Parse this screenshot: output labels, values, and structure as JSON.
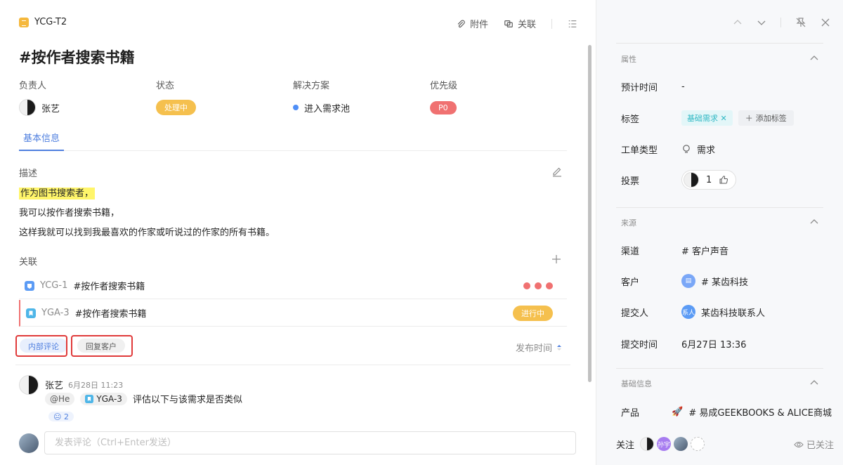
{
  "header": {
    "ticket_id": "YCG-T2",
    "attach_label": "附件",
    "link_label": "关联"
  },
  "title": "#按作者搜索书籍",
  "meta": {
    "assignee_label": "负责人",
    "assignee_name": "张艺",
    "status_label": "状态",
    "status_value": "处理中",
    "solution_label": "解决方案",
    "solution_value": "进入需求池",
    "priority_label": "优先级",
    "priority_value": "P0"
  },
  "tabs": [
    {
      "label": "基本信息",
      "active": true
    }
  ],
  "description": {
    "label": "描述",
    "lines": [
      "作为图书搜索者，",
      "我可以按作者搜索书籍，",
      "这样我就可以找到我最喜欢的作家或听说过的作家的所有书籍。"
    ]
  },
  "relations": {
    "label": "关联",
    "items": [
      {
        "id": "YCG-1",
        "title": "#按作者搜索书籍",
        "icon_color": "#5b9bf5",
        "status": "",
        "dots": 3
      },
      {
        "id": "YGA-3",
        "title": "#按作者搜索书籍",
        "icon_color": "#4fb6e8",
        "status": "进行中",
        "dots": 0
      }
    ]
  },
  "comments": {
    "tab_internal": "内部评论",
    "tab_reply": "回复客户",
    "sort_label": "发布时间",
    "items": [
      {
        "author": "张艺",
        "time": "6月28日 11:23",
        "mention": "@He",
        "ref": "YGA-3",
        "text": "评估以下与该需求是否类似",
        "reaction": "😐 2"
      }
    ],
    "input_placeholder": "发表评论（Ctrl+Enter发送）"
  },
  "sidebar": {
    "attributes": {
      "title": "属性",
      "est_time_label": "预计时间",
      "est_time_value": "-",
      "tags_label": "标签",
      "tag": "基础需求",
      "add_tag": "添加标签",
      "type_label": "工单类型",
      "type_value": "需求",
      "vote_label": "投票",
      "vote_count": "1"
    },
    "source": {
      "title": "来源",
      "channel_label": "渠道",
      "channel_value": "# 客户声音",
      "customer_label": "客户",
      "customer_value": "# 某齿科技",
      "submitter_label": "提交人",
      "submitter_badge": "系人",
      "submitter_value": "某齿科技联系人",
      "submit_time_label": "提交时间",
      "submit_time_value": "6月27日 13:36"
    },
    "basic": {
      "title": "基础信息",
      "product_label": "产品",
      "product_value": "# 易成GEEKBOOKS & ALICE商城"
    },
    "footer": {
      "follow_label": "关注",
      "follower_badge": "孙宇",
      "followed_label": "已关注"
    }
  },
  "colors": {
    "accent": "#4f7fdf",
    "status_yellow": "#f5c04e",
    "priority_red": "#f07171",
    "highlight": "#fff56a"
  }
}
